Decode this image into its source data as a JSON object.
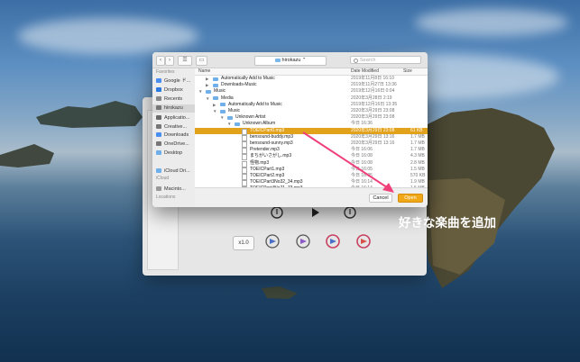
{
  "dialog": {
    "location": "hirokazu",
    "search_placeholder": "Search",
    "cancel_label": "Cancel",
    "open_label": "Open",
    "columns": {
      "name": "Name",
      "date": "Date Modified",
      "size": "Size"
    }
  },
  "sidebar": {
    "favorites_header": "Favorites",
    "icloud_header": "iCloud",
    "locations_header": "Locations",
    "items": [
      {
        "label": "Google ド...",
        "icon": "google-drive-icon"
      },
      {
        "label": "Dropbox",
        "icon": "dropbox-icon"
      },
      {
        "label": "Recents",
        "icon": "clock-icon"
      },
      {
        "label": "hirokazu",
        "icon": "home-icon"
      },
      {
        "label": "Applicatio...",
        "icon": "applications-icon"
      },
      {
        "label": "Creative...",
        "icon": "folder-icon"
      },
      {
        "label": "Downloads",
        "icon": "downloads-icon"
      },
      {
        "label": "OneDrive...",
        "icon": "folder-icon"
      },
      {
        "label": "Desktop",
        "icon": "desktop-icon"
      },
      {
        "label": "iCloud Dri...",
        "icon": "cloud-icon"
      },
      {
        "label": "Macinto...",
        "icon": "disk-icon"
      }
    ]
  },
  "files": [
    {
      "name": "Automatically Add to Music",
      "date": "2019年11月8日 16:10",
      "size": "",
      "kind": "folder",
      "indent": 1
    },
    {
      "name": "Downloads-Music",
      "date": "2019年11月27日 13:36",
      "size": "",
      "kind": "folder",
      "indent": 1
    },
    {
      "name": "Music",
      "date": "2019年12月16日 0:04",
      "size": "",
      "kind": "folder",
      "indent": 0
    },
    {
      "name": "Media",
      "date": "2020年3月28日 2:19",
      "size": "",
      "kind": "folder",
      "indent": 1
    },
    {
      "name": "Automatically Add to Music",
      "date": "2019年12月16日 13:35",
      "size": "",
      "kind": "folder",
      "indent": 2
    },
    {
      "name": "Music",
      "date": "2020年3月29日 23:08",
      "size": "",
      "kind": "folder",
      "indent": 2
    },
    {
      "name": "Unknown Artist",
      "date": "2020年3月29日 23:08",
      "size": "",
      "kind": "folder",
      "indent": 3
    },
    {
      "name": "Unknown Album",
      "date": "今日 16:36",
      "size": "",
      "kind": "folder",
      "indent": 4
    },
    {
      "name": "TOEICPart0.mp3",
      "date": "2020年3月29日 23:08",
      "size": "61 KB",
      "kind": "file",
      "indent": 5,
      "selected": true
    },
    {
      "name": "bensound-buddy.mp3",
      "date": "2020年3月29日 13:16",
      "size": "1.7 MB",
      "kind": "file",
      "indent": 5
    },
    {
      "name": "bensound-sunny.mp3",
      "date": "2020年3月29日 13:16",
      "size": "1.7 MB",
      "kind": "file",
      "indent": 5
    },
    {
      "name": "Pretender.mp3",
      "date": "今日 16:06",
      "size": "1.7 MB",
      "kind": "file",
      "indent": 5
    },
    {
      "name": "まちがいさがし.mp3",
      "date": "今日 16:08",
      "size": "4.3 MB",
      "kind": "file",
      "indent": 5
    },
    {
      "name": "怪物.mp3",
      "date": "今日 16:08",
      "size": "2.8 MB",
      "kind": "file",
      "indent": 5
    },
    {
      "name": "TOEICPart1.mp3",
      "date": "今日 16:05",
      "size": "1.5 MB",
      "kind": "file",
      "indent": 5
    },
    {
      "name": "TOEICPart2.mp3",
      "date": "今日 16:05",
      "size": "570 KB",
      "kind": "file",
      "indent": 5
    },
    {
      "name": "TOEICPart3No32_34.mp3",
      "date": "今日 16:14",
      "size": "1.9 MB",
      "kind": "file",
      "indent": 5
    },
    {
      "name": "TOEICPart4No71_73.mp3",
      "date": "今日 16:14",
      "size": "1.5 MB",
      "kind": "file",
      "indent": 5
    }
  ],
  "app": {
    "version_label": "x1.0"
  },
  "caption": "好きな楽曲を追加",
  "colors": {
    "accent": "#f0a818",
    "arrow": "#f0407a",
    "selection": "#e3a21c"
  }
}
